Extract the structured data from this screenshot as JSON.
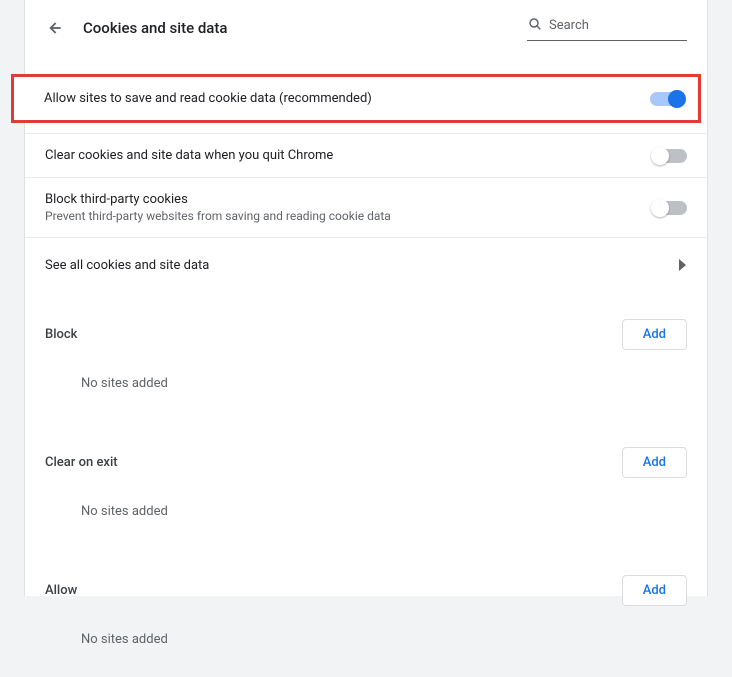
{
  "header": {
    "title": "Cookies and site data",
    "search_placeholder": "Search"
  },
  "settings": [
    {
      "label": "Allow sites to save and read cookie data (recommended)",
      "sub": "",
      "enabled": true,
      "highlight": true
    },
    {
      "label": "Clear cookies and site data when you quit Chrome",
      "sub": "",
      "enabled": false,
      "highlight": false
    },
    {
      "label": "Block third-party cookies",
      "sub": "Prevent third-party websites from saving and reading cookie data",
      "enabled": false,
      "highlight": false
    }
  ],
  "link_row": {
    "label": "See all cookies and site data"
  },
  "site_sections": [
    {
      "title": "Block",
      "empty": "No sites added",
      "add_label": "Add"
    },
    {
      "title": "Clear on exit",
      "empty": "No sites added",
      "add_label": "Add"
    },
    {
      "title": "Allow",
      "empty": "No sites added",
      "add_label": "Add"
    }
  ]
}
